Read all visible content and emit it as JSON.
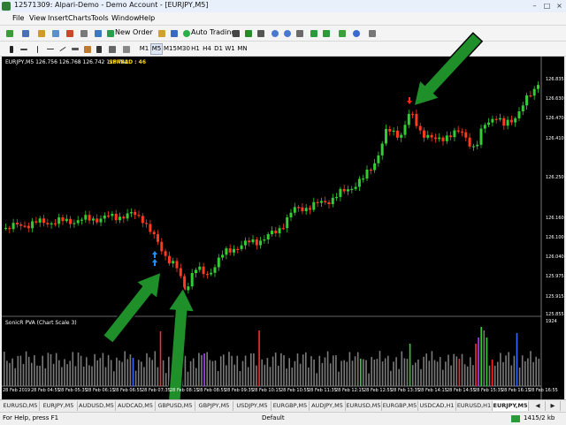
{
  "window": {
    "title": "12571309: Alpari-Demo - Demo Account - [EURJPY,M5]"
  },
  "menu": [
    "File",
    "View",
    "Insert",
    "Charts",
    "Tools",
    "Window",
    "Help"
  ],
  "toolbar": {
    "new_order": "New Order",
    "auto_trading": "Auto Trading"
  },
  "timeframes": [
    "M1",
    "M5",
    "M15",
    "M30",
    "H1",
    "H4",
    "D1",
    "W1",
    "MN"
  ],
  "active_timeframe": "M5",
  "chart": {
    "info": "EURJPY,M5  126.756 126.768 126.742 126.742",
    "spread": "SPREAD : 46",
    "indicator_label": "SonicR PVA  (Chart Scale 3)",
    "volume_axis_top": "1924",
    "price_ticks": [
      "126.835",
      "126.630",
      "126.470",
      "126.410",
      "126.250",
      "126.160",
      "126.100",
      "126.040",
      "125.975",
      "125.915",
      "125.855"
    ],
    "time_ticks": [
      "28 Feb 2019",
      "28 Feb 04:55",
      "28 Feb 05:35",
      "28 Feb 06:15",
      "28 Feb 06:55",
      "28 Feb 07:35",
      "28 Feb 08:15",
      "28 Feb 08:55",
      "28 Feb 09:35",
      "28 Feb 10:15",
      "28 Feb 10:55",
      "28 Feb 11:35",
      "28 Feb 12:15",
      "28 Feb 12:55",
      "28 Feb 13:35",
      "28 Feb 14:15",
      "28 Feb 14:55",
      "28 Feb 15:35",
      "28 Feb 16:15",
      "28 Feb 16:55"
    ],
    "colors": {
      "bull": "#32cd32",
      "bear": "#ff3b1f",
      "bg": "#000000",
      "arrow_up": "#1e90ff",
      "arrow_down": "#ff2a00",
      "annotation": "#1f8f2a"
    }
  },
  "tabs": [
    "EURUSD,M5",
    "EURJPY,M5",
    "AUDUSD,M5",
    "AUDCAD,M5",
    "GBPUSD,M5",
    "GBPJPY,M5",
    "USDJPY,M5",
    "EURGBP,M5",
    "AUDJPY,M5",
    "EURUSD,M5",
    "EURGBP,M5",
    "USDCAD,H1",
    "EURUSD,H1",
    "EURJPY,M5"
  ],
  "active_tab": 13,
  "status": {
    "help": "For Help, press F1",
    "profile": "Default",
    "traffic": "1415/2 kb"
  }
}
